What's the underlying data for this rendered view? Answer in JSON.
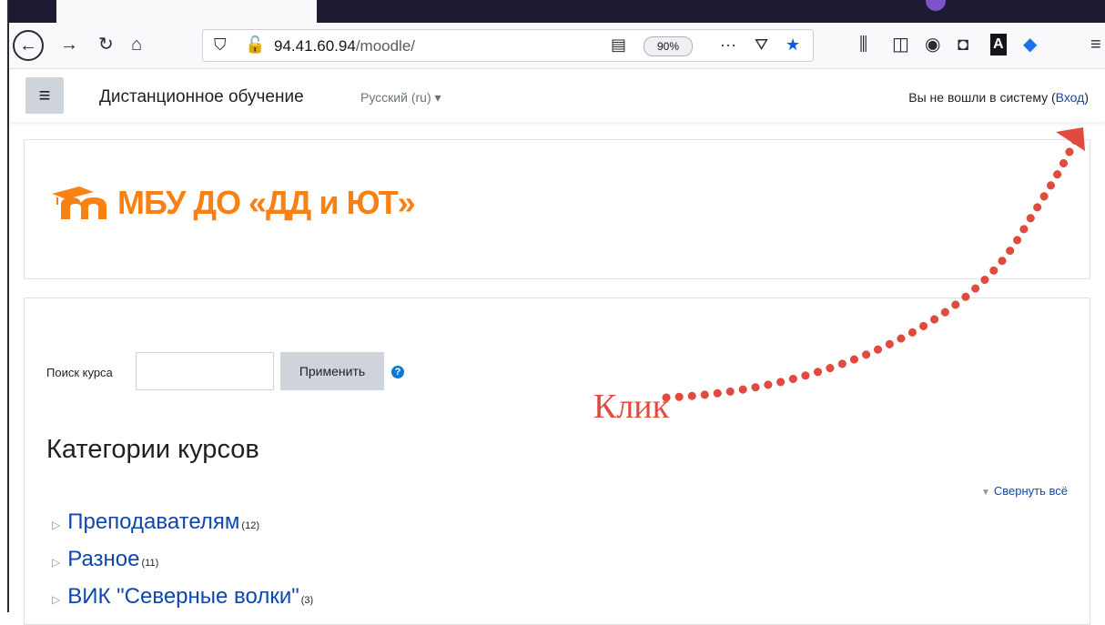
{
  "browser": {
    "url_host": "94.41.60.94",
    "url_path": "/moodle/",
    "zoom": "90%"
  },
  "navbar": {
    "site_name": "Дистанционное обучение",
    "language": "Русский (ru)",
    "login_status": "Вы не вошли в систему (",
    "login_link": "Вход",
    "login_close": ")"
  },
  "header": {
    "logo_text": "МБУ ДО «ДД и ЮТ»"
  },
  "search": {
    "label": "Поиск курса",
    "value": "",
    "button": "Применить"
  },
  "categories": {
    "heading": "Категории курсов",
    "collapse_all": "Свернуть всё",
    "items": [
      {
        "name": "Преподавателям",
        "count": "(12)"
      },
      {
        "name": "Разное",
        "count": "(11)"
      },
      {
        "name": "ВИК \"Северные волки\"",
        "count": "(3)"
      }
    ]
  },
  "annotation": {
    "label": "Клик",
    "color": "#e04b3f"
  },
  "colors": {
    "brand_orange": "#f98012",
    "link_blue": "#0f47ad",
    "button_gray": "#ced4da"
  }
}
